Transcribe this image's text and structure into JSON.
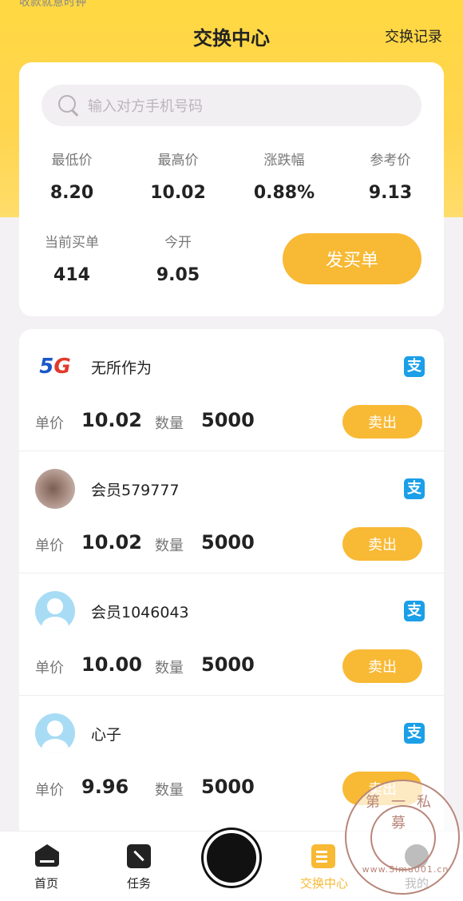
{
  "status_bar": {
    "text": "收款就意时钟"
  },
  "header": {
    "title": "交换中心",
    "history_link": "交换记录"
  },
  "search": {
    "placeholder": "输入对方手机号码"
  },
  "stats": {
    "low_label": "最低价",
    "low_value": "8.20",
    "high_label": "最高价",
    "high_value": "10.02",
    "change_label": "涨跌幅",
    "change_value": "0.88%",
    "ref_label": "参考价",
    "ref_value": "9.13",
    "orders_label": "当前买单",
    "orders_value": "414",
    "open_label": "今开",
    "open_value": "9.05"
  },
  "buy_button": "发买单",
  "list": {
    "price_label": "单价",
    "qty_label": "数量",
    "sell_label": "卖出",
    "pay_icon": "支",
    "rows": [
      {
        "name": "无所作为",
        "avatar": "5g-logo",
        "price": "10.02",
        "qty": "5000"
      },
      {
        "name": "会员579777",
        "avatar": "photo",
        "price": "10.02",
        "qty": "5000"
      },
      {
        "name": "会员1046043",
        "avatar": "default-user",
        "price": "10.00",
        "qty": "5000"
      },
      {
        "name": "心子",
        "avatar": "default-user",
        "price": "9.96",
        "qty": "5000"
      }
    ]
  },
  "tabbar": {
    "home": "首页",
    "task": "任务",
    "exchange": "交换中心",
    "mine": "我的"
  },
  "watermark": {
    "top": "第一私募",
    "url": "www.Simu001.cn"
  },
  "colors": {
    "accent": "#f8b934",
    "header_bg": "#ffd842",
    "pay_blue": "#1a9fe8"
  }
}
